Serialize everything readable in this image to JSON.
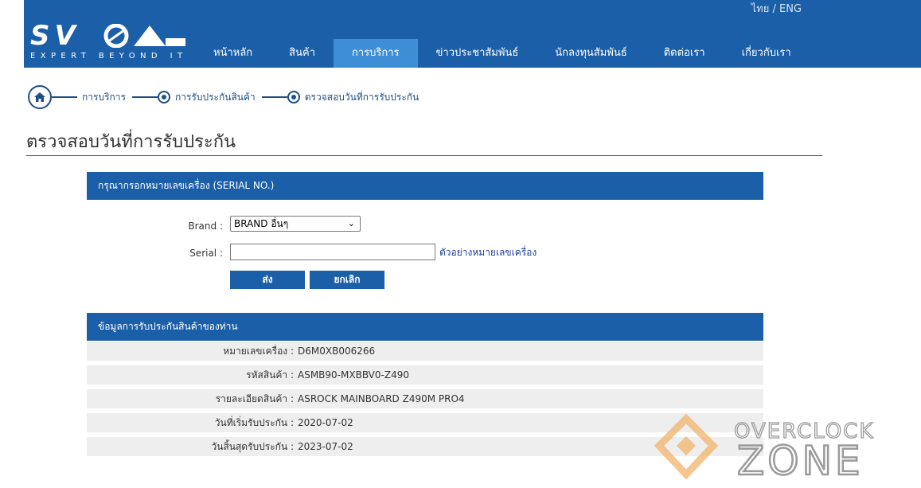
{
  "header": {
    "lang": "ไทย / ENG",
    "logo_text": "SVOA",
    "logo_tagline": "EXPERT BEYOND IT",
    "nav": [
      {
        "label": "หน้าหลัก",
        "active": false
      },
      {
        "label": "สินค้า",
        "active": false
      },
      {
        "label": "การบริการ",
        "active": true
      },
      {
        "label": "ข่าวประชาสัมพันธ์",
        "active": false
      },
      {
        "label": "นักลงทุนสัมพันธ์",
        "active": false
      },
      {
        "label": "ติดต่อเรา",
        "active": false
      },
      {
        "label": "เกี่ยวกับเรา",
        "active": false
      }
    ]
  },
  "breadcrumb": {
    "items": [
      "การบริการ",
      "การรับประกันสินค้า",
      "ตรวจสอบวันที่การรับประกัน"
    ]
  },
  "page_title": "ตรวจสอบวันที่การรับประกัน",
  "form": {
    "header": "กรุณากรอกหมายเลขเครื่อง (SERIAL NO.)",
    "brand_label": "Brand :",
    "brand_value": "BRAND อื่นๆ",
    "serial_label": "Serial :",
    "serial_value": "",
    "example_link": "ตัวอย่างหมายเลขเครื่อง",
    "submit_label": "ส่ง",
    "cancel_label": "ยกเลิก"
  },
  "warranty": {
    "header": "ข้อมูลการรับประกันสินค้าของท่าน",
    "rows": [
      {
        "key": "หมายเลขเครื่อง :",
        "value": "D6M0XB006266"
      },
      {
        "key": "รหัสสินค้า :",
        "value": "ASMB90-MXBBV0-Z490"
      },
      {
        "key": "รายละเอียดสินค้า :",
        "value": "ASROCK MAINBOARD Z490M PRO4"
      },
      {
        "key": "วันที่เริ่มรับประกัน :",
        "value": "2020-07-02"
      },
      {
        "key": "วันสิ้นสุดรับประกัน :",
        "value": "2023-07-02"
      }
    ]
  },
  "watermark": {
    "line1": "OVERCLOCK",
    "line2": "ZONE"
  },
  "colors": {
    "brand_blue": "#1b5fa8",
    "active_tab": "#3d8ed5",
    "link": "#1d3f94",
    "watermark": "#f2a85a"
  }
}
